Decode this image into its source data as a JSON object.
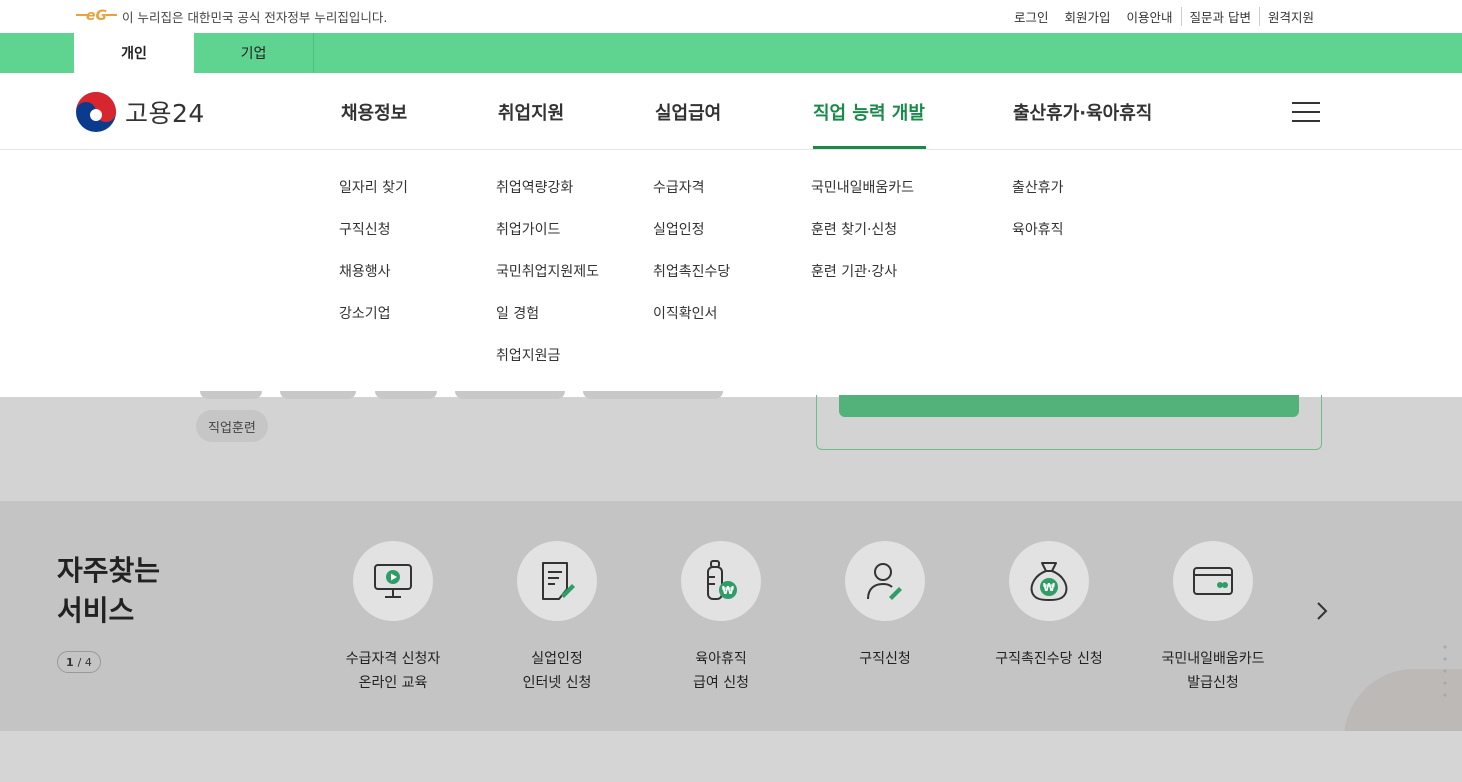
{
  "topbar": {
    "gov_notice": "이 누리집은 대한민국 공식 전자정부 누리집입니다.",
    "links": [
      "로그인",
      "회원가입",
      "이용안내",
      "질문과 답변",
      "원격지원"
    ]
  },
  "tabs": {
    "personal": "개인",
    "corporate": "기업"
  },
  "logo": {
    "text": "고용24"
  },
  "nav": [
    {
      "label": "채용정보"
    },
    {
      "label": "취업지원"
    },
    {
      "label": "실업급여"
    },
    {
      "label": "직업 능력 개발"
    },
    {
      "label": "출산휴가·육아휴직"
    }
  ],
  "dropdown": {
    "col1": [
      "일자리 찾기",
      "구직신청",
      "채용행사",
      "강소기업"
    ],
    "col2": [
      "취업역량강화",
      "취업가이드",
      "국민취업지원제도",
      "일 경험",
      "취업지원금"
    ],
    "col3": [
      "수급자격",
      "실업인정",
      "취업촉진수당",
      "이직확인서"
    ],
    "col4": [
      "국민내일배움카드",
      "훈련 찾기·신청",
      "훈련 기관·강사"
    ],
    "col5": [
      "출산휴가",
      "육아휴직"
    ]
  },
  "content": {
    "chip": "직업훈련"
  },
  "services": {
    "title": "자주찾는\n서비스",
    "pager_current": "1",
    "pager_total": "/ 4",
    "items": [
      {
        "label": "수급자격 신청자\n온라인 교육",
        "icon": "monitor-play-icon"
      },
      {
        "label": "실업인정\n인터넷 신청",
        "icon": "document-pen-icon"
      },
      {
        "label": "육아휴직\n급여 신청",
        "icon": "baby-bottle-won-icon"
      },
      {
        "label": "구직신청",
        "icon": "person-pen-icon"
      },
      {
        "label": "구직촉진수당 신청",
        "icon": "money-bag-won-icon"
      },
      {
        "label": "국민내일배움카드\n발급신청",
        "icon": "card-icon"
      }
    ]
  },
  "colors": {
    "brand_green": "#5fd491",
    "nav_active": "#1a8a4a",
    "icon_accent": "#2e9e66"
  }
}
